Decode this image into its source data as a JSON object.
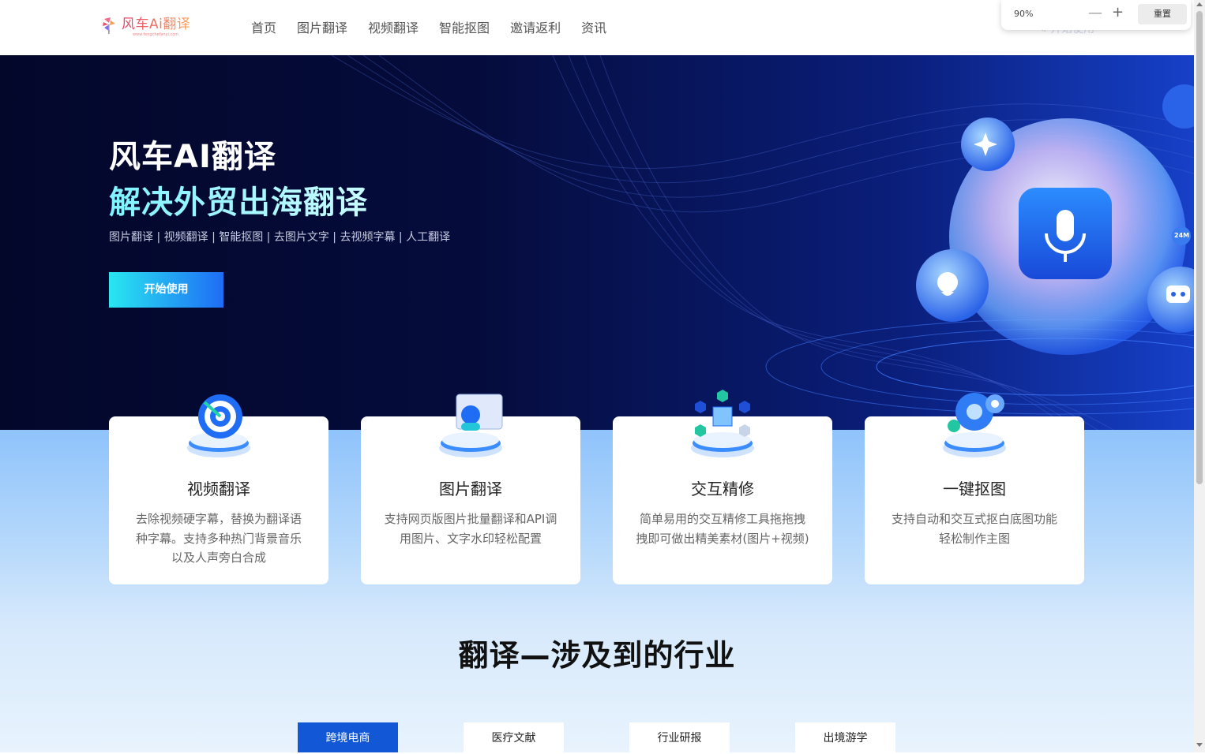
{
  "header": {
    "logo_text": "风车Ai翻译",
    "logo_url": "www.fengchefanyi.com",
    "nav": [
      "首页",
      "图片翻译",
      "视频翻译",
      "智能抠图",
      "邀请返利",
      "资讯"
    ],
    "cta_ghost": "开始使用"
  },
  "zoom": {
    "percent": "90%",
    "minus": "—",
    "plus": "+",
    "reset": "重置"
  },
  "hero": {
    "title": "风车AI翻译",
    "subtitle": "解决外贸出海翻译",
    "tags": "图片翻译 | 视频翻译 | 智能抠图 | 去图片文字 | 去视频字幕 | 人工翻译",
    "cta": "开始使用",
    "badge": "24M"
  },
  "features": [
    {
      "title": "视频翻译",
      "desc": "去除视频硬字幕，替换为翻译语种字幕。支持多种热门背景音乐以及人声旁白合成",
      "icon": "target-icon"
    },
    {
      "title": "图片翻译",
      "desc": "支持网页版图片批量翻译和API调用图片、文字水印轻松配置",
      "icon": "image-translate-icon"
    },
    {
      "title": "交互精修",
      "desc": "简单易用的交互精修工具拖拖拽拽即可做出精美素材(图片+视频)",
      "icon": "cube-network-icon"
    },
    {
      "title": "一键抠图",
      "desc": "支持自动和交互式抠白底图功能轻松制作主图",
      "icon": "gear-icon"
    }
  ],
  "industries": {
    "title": "翻译—涉及到的行业",
    "tabs": [
      "跨境电商",
      "医疗文献",
      "行业研报",
      "出境游学"
    ],
    "active": 0
  },
  "colors": {
    "accent": "#1157d6",
    "hero_dark": "#03072a",
    "cta_start": "#28e7f0",
    "cta_end": "#1f6cf5"
  }
}
